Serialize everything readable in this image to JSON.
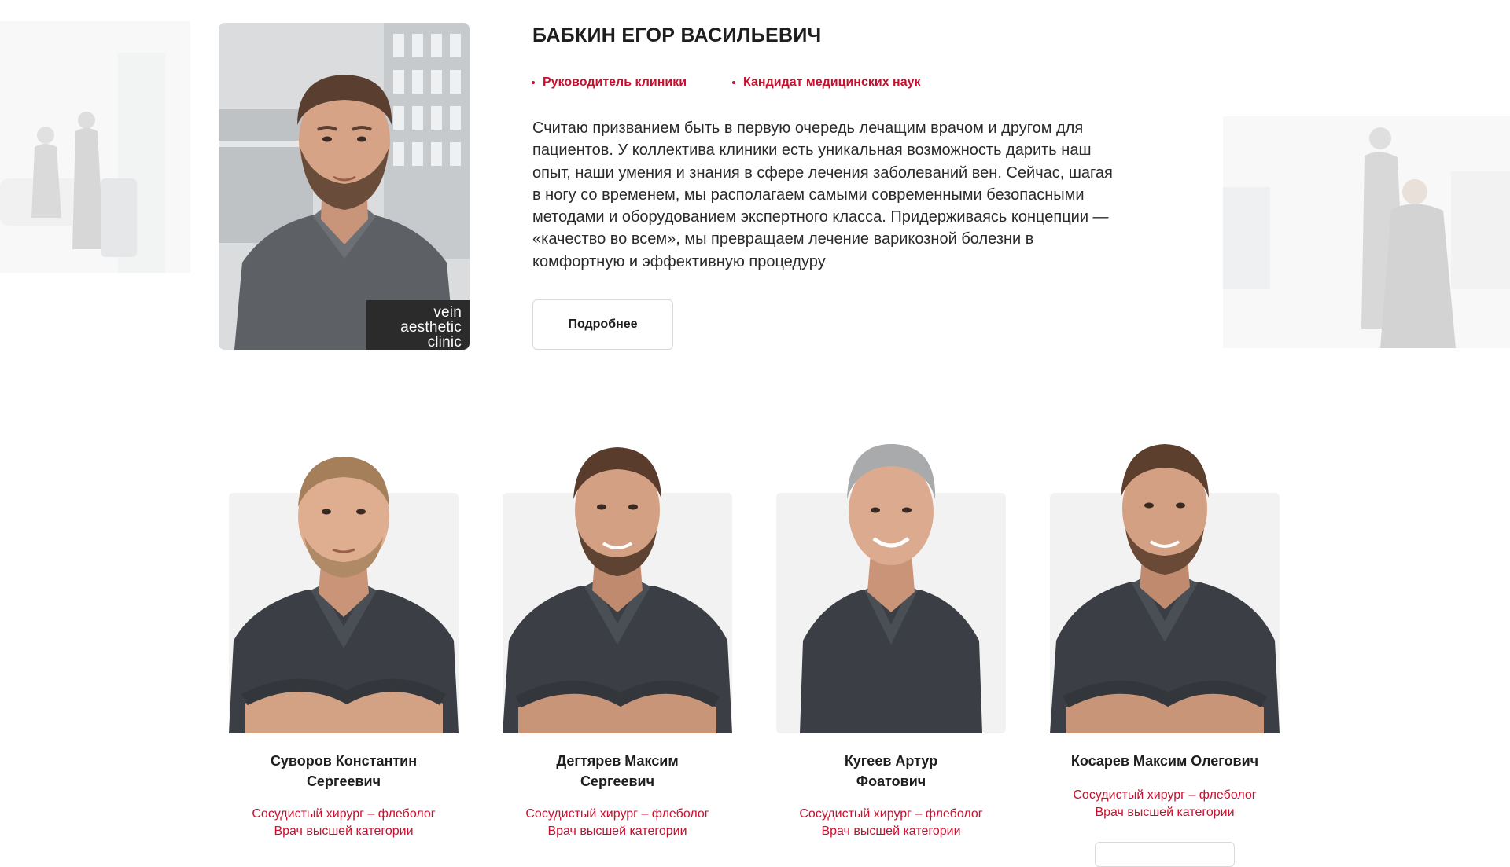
{
  "colors": {
    "accent": "#c8102e",
    "text": "#1e1e1e",
    "card_bg": "#f2f2f3",
    "scrubs": "#3b3e44"
  },
  "lead_doctor": {
    "name": "БАБКИН ЕГОР ВАСИЛЬЕВИЧ",
    "tags": [
      "Руководитель клиники",
      "Кандидат медицинских наук"
    ],
    "bio": "Считаю призванием быть в первую очередь лечащим врачом и другом для пациентов. У коллектива клиники есть уникальная возможность дарить наш опыт, наши умения и знания в сфере лечения заболеваний вен. Сейчас, шагая в ногу со временем, мы располагаем самыми современными безопасными методами и оборудованием экспертного класса. Придерживаясь концепции — «качество во всем», мы превращаем лечение варикозной болезни в комфортную и эффективную процедуру",
    "more_button": "Подробнее",
    "logo": {
      "line1": "vein",
      "line2": "aesthetic",
      "line3": "clinic"
    }
  },
  "team": [
    {
      "name_line1": "Суворов Константин",
      "name_line2": "Сергеевич",
      "role_line1": "Сосудистый хирург – флеболог",
      "role_line2": "Врач высшей категории"
    },
    {
      "name_line1": "Дегтярев Максим",
      "name_line2": "Сергеевич",
      "role_line1": "Сосудистый хирург – флеболог",
      "role_line2": "Врач высшей категории"
    },
    {
      "name_line1": "Кугеев Артур",
      "name_line2": "Фоатович",
      "role_line1": "Сосудистый хирург – флеболог",
      "role_line2": "Врач высшей категории"
    },
    {
      "name_line1": "Косарев Максим Олегович",
      "name_line2": "",
      "role_line1": "Сосудистый хирург – флеболог",
      "role_line2": "Врач высшей категории"
    }
  ]
}
